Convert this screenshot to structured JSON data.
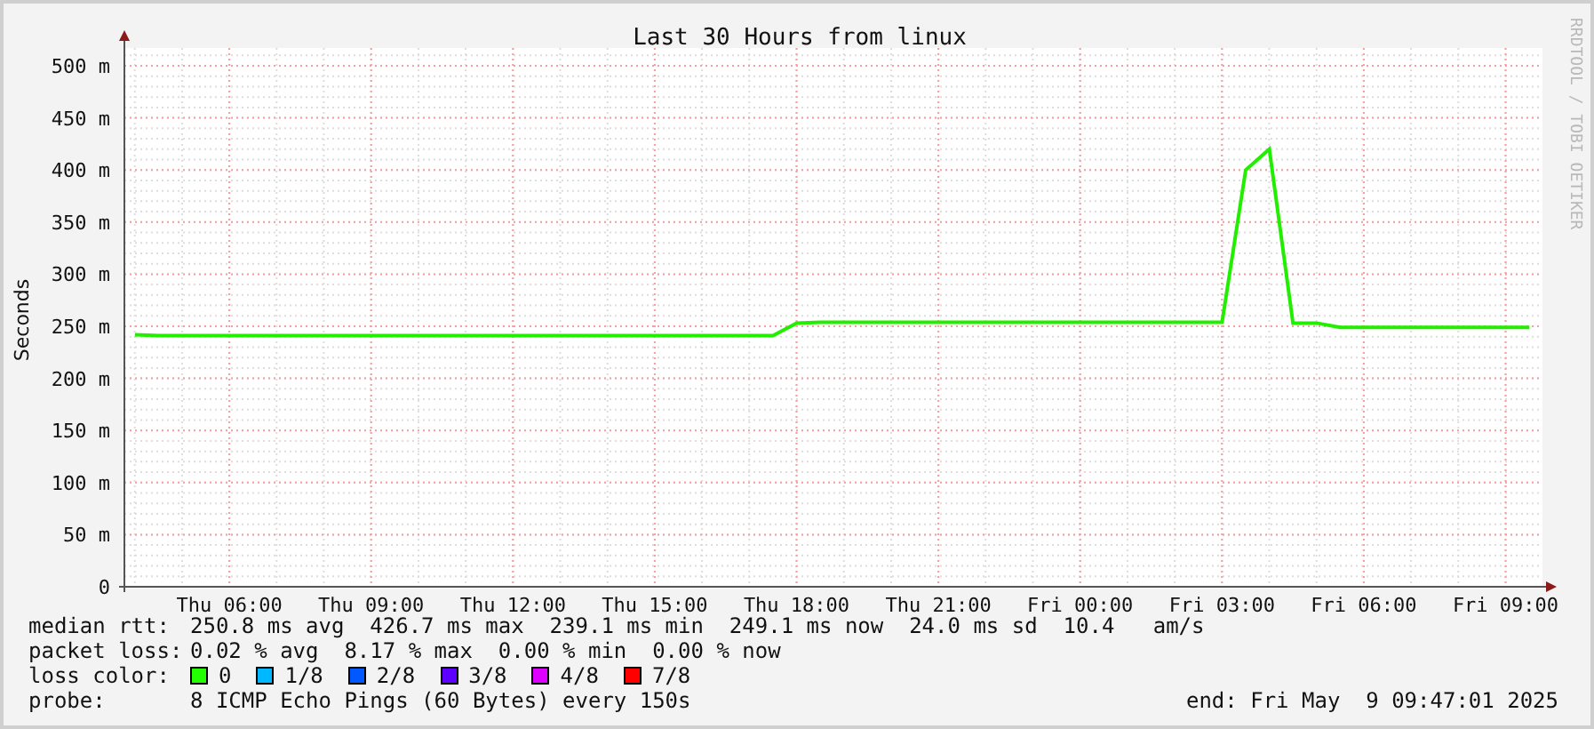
{
  "chart": {
    "credit": "RRDTOOL / TOBI OETIKER",
    "chart_data": {
      "type": "line",
      "grid": true,
      "title": "Last 30 Hours from linux",
      "ylabel": "Seconds",
      "ylim": [
        0,
        500
      ],
      "categories": [
        null,
        null,
        null,
        null,
        "Thu 06:00",
        null,
        null,
        null,
        null,
        null,
        "Thu 09:00",
        null,
        null,
        null,
        null,
        null,
        "Thu 12:00",
        null,
        null,
        null,
        null,
        null,
        "Thu 15:00",
        null,
        null,
        null,
        null,
        null,
        "Thu 18:00",
        null,
        null,
        null,
        null,
        null,
        "Thu 21:00",
        null,
        null,
        null,
        null,
        null,
        "Fri 00:00",
        null,
        null,
        null,
        null,
        null,
        "Fri 03:00",
        null,
        null,
        null,
        null,
        null,
        "Fri 06:00",
        null,
        null,
        null,
        null,
        null,
        "Fri 09:00",
        null
      ],
      "series": [
        {
          "name": "median rtt:",
          "color": "#22ee00",
          "values": [
            242,
            241,
            241,
            241,
            241,
            241,
            241,
            241,
            241,
            241,
            241,
            241,
            241,
            241,
            241,
            241,
            241,
            241,
            241,
            241,
            241,
            241,
            241,
            241,
            241,
            241,
            241,
            241,
            253,
            254,
            254,
            254,
            254,
            254,
            254,
            254,
            254,
            254,
            254,
            254,
            254,
            254,
            254,
            254,
            254,
            254,
            254,
            400,
            420,
            253,
            253,
            249,
            249,
            249,
            249,
            249,
            249,
            249,
            249,
            249
          ]
        }
      ],
      "yticks": [
        {
          "value": 0,
          "label": "0"
        },
        {
          "value": 50,
          "label": "50 m"
        },
        {
          "value": 100,
          "label": "100 m"
        },
        {
          "value": 150,
          "label": "150 m"
        },
        {
          "value": 200,
          "label": "200 m"
        },
        {
          "value": 250,
          "label": "250 m"
        },
        {
          "value": 300,
          "label": "300 m"
        },
        {
          "value": 350,
          "label": "350 m"
        },
        {
          "value": 400,
          "label": "400 m"
        },
        {
          "value": 450,
          "label": "450 m"
        },
        {
          "value": 500,
          "label": "500 m"
        }
      ]
    }
  },
  "legend": {
    "median_rtt": {
      "text": "250.8 ms avg  426.7 ms max  239.1 ms min  249.1 ms now  24.0 ms sd  10.4   am/s"
    },
    "packet_loss": {
      "label": "packet loss:",
      "text": "0.02 % avg  8.17 % max  0.00 % min  0.00 % now"
    },
    "loss_color": {
      "label": "loss color:",
      "items": [
        {
          "label": "0",
          "color": "#22ff00"
        },
        {
          "label": "1/8",
          "color": "#00b8ff"
        },
        {
          "label": "2/8",
          "color": "#0059ff"
        },
        {
          "label": "3/8",
          "color": "#5e00ff"
        },
        {
          "label": "4/8",
          "color": "#dd00ff"
        },
        {
          "label": "7/8",
          "color": "#ff0000"
        }
      ]
    },
    "probe": {
      "label": "probe:",
      "text": "8 ICMP Echo Pings (60 Bytes) every 150s"
    },
    "end": "end: Fri May  9 09:47:01 2025"
  }
}
